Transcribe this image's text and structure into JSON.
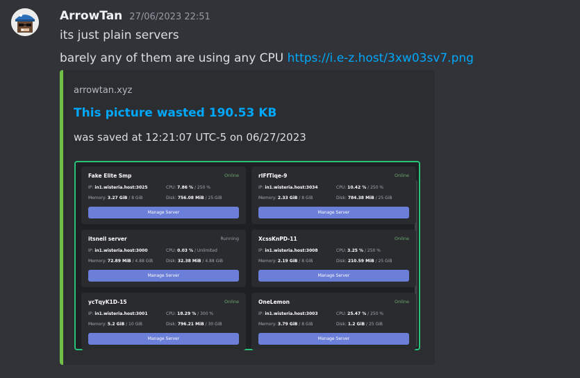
{
  "message": {
    "username": "ArrowTan",
    "timestamp": "27/06/2023 22:51",
    "line1": "its just plain servers",
    "line2_text": "barely any of them are using any CPU ",
    "line2_link": "https://i.e-z.host/3xw03sv7.png"
  },
  "embed": {
    "provider": "arrowtan.xyz",
    "title": "This picture wasted 190.53 KB",
    "description": "was saved at 12:21:07 UTC-5 on 06/27/2023",
    "accent_color": "#70c047"
  },
  "servers": [
    {
      "name": "Fake Elite Smp",
      "status": "Online",
      "ip_label": "IP: ",
      "ip": "in1.wisteria.host:3025",
      "cpu_label": "CPU: ",
      "cpu": "7.86 %",
      "cpu_limit": " / 250 %",
      "mem_label": "Memory: ",
      "mem": "3.27 GiB",
      "mem_limit": " / 8 GiB",
      "disk_label": "Disk: ",
      "disk": "756.08 MiB",
      "disk_limit": " / 25 GiB",
      "button": "Manage Server"
    },
    {
      "name": "rIFfTiqe-9",
      "status": "Online",
      "ip_label": "IP: ",
      "ip": "in1.wisteria.host:3034",
      "cpu_label": "CPU: ",
      "cpu": "10.42 %",
      "cpu_limit": " / 250 %",
      "mem_label": "Memory: ",
      "mem": "2.33 GiB",
      "mem_limit": " / 8 GiB",
      "disk_label": "Disk: ",
      "disk": "784.38 MiB",
      "disk_limit": " / 25 GiB",
      "button": "Manage Server"
    },
    {
      "name": "itsneil server",
      "status": "Running",
      "ip_label": "IP: ",
      "ip": "in1.wisteria.host:3000",
      "cpu_label": "CPU: ",
      "cpu": "0.03 %",
      "cpu_limit": " / Unlimited",
      "mem_label": "Memory: ",
      "mem": "72.89 MiB",
      "mem_limit": " / 4.88 GiB",
      "disk_label": "Disk: ",
      "disk": "32.38 MiB",
      "disk_limit": " / 4.88 GiB",
      "button": "Manage Server"
    },
    {
      "name": "XcssKnPD-11",
      "status": "Online",
      "ip_label": "IP: ",
      "ip": "in1.wisteria.host:3008",
      "cpu_label": "CPU: ",
      "cpu": "3.25 %",
      "cpu_limit": " / 250 %",
      "mem_label": "Memory: ",
      "mem": "2.19 GiB",
      "mem_limit": " / 8 GiB",
      "disk_label": "Disk: ",
      "disk": "210.59 MiB",
      "disk_limit": " / 25 GiB",
      "button": "Manage Server"
    },
    {
      "name": "ycTqyK1D-15",
      "status": "Online",
      "ip_label": "IP: ",
      "ip": "in1.wisteria.host:3001",
      "cpu_label": "CPU: ",
      "cpu": "18.29 %",
      "cpu_limit": " / 300 %",
      "mem_label": "Memory: ",
      "mem": "5.2 GiB",
      "mem_limit": " / 10 GiB",
      "disk_label": "Disk: ",
      "disk": "796.21 MiB",
      "disk_limit": " / 30 GiB",
      "button": "Manage Server"
    },
    {
      "name": "OneLemon",
      "status": "Online",
      "ip_label": "IP: ",
      "ip": "in1.wisteria.host:3003",
      "cpu_label": "CPU: ",
      "cpu": "25.47 %",
      "cpu_limit": " / 250 %",
      "mem_label": "Memory: ",
      "mem": "3.79 GiB",
      "mem_limit": " / 8 GiB",
      "disk_label": "Disk: ",
      "disk": "1.2 GiB",
      "disk_limit": " / 25 GiB",
      "button": "Manage Server"
    }
  ]
}
